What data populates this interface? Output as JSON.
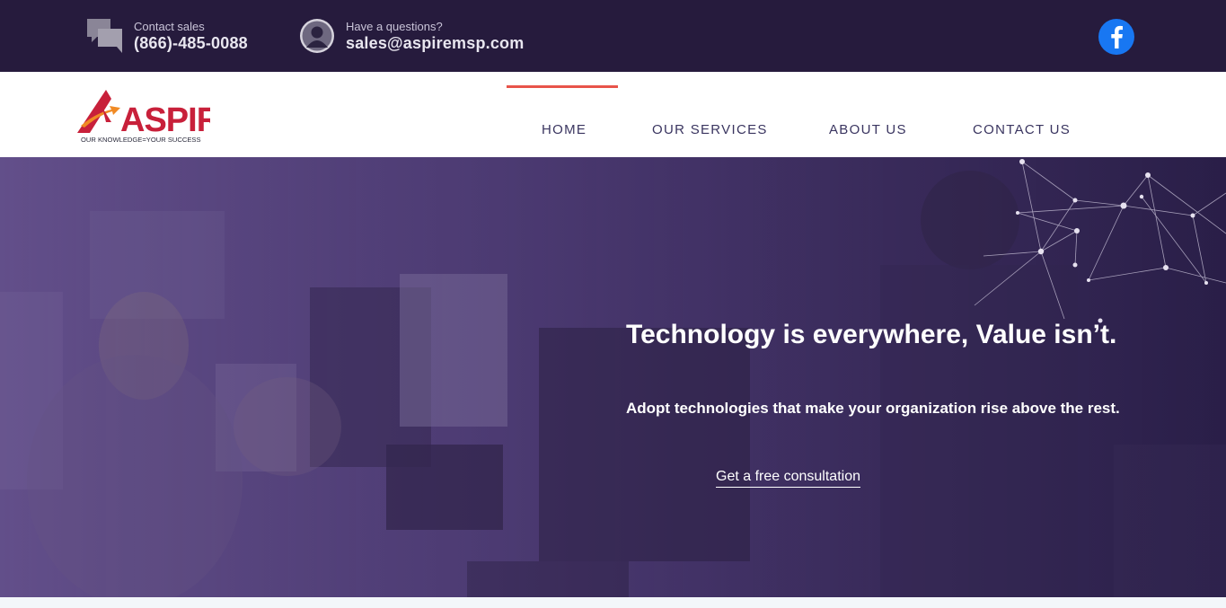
{
  "topbar": {
    "sales_label": "Contact sales",
    "sales_phone": "(866)-485-0088",
    "email_label": "Have a questions?",
    "email_value": "sales@aspiremsp.com",
    "social_icon": "facebook-icon"
  },
  "logo": {
    "name": "ASPIRE",
    "tagline": "OUR KNOWLEDGE=YOUR SUCCESS"
  },
  "nav": {
    "items": [
      {
        "label": "HOME",
        "active": true
      },
      {
        "label": "OUR SERVICES",
        "active": false
      },
      {
        "label": "ABOUT US",
        "active": false
      },
      {
        "label": "CONTACT US",
        "active": false
      }
    ]
  },
  "hero": {
    "headline": "Technology is everywhere, Value isn’t.",
    "subheadline": "Adopt technologies that make your organization rise above the rest.",
    "cta_label": "Get a free consultation"
  },
  "colors": {
    "topbar_bg": "#261b3d",
    "accent": "#e8544a",
    "brand_red": "#c8203a",
    "nav_text": "#3a3560",
    "hero_overlay": "#4c3a73"
  }
}
